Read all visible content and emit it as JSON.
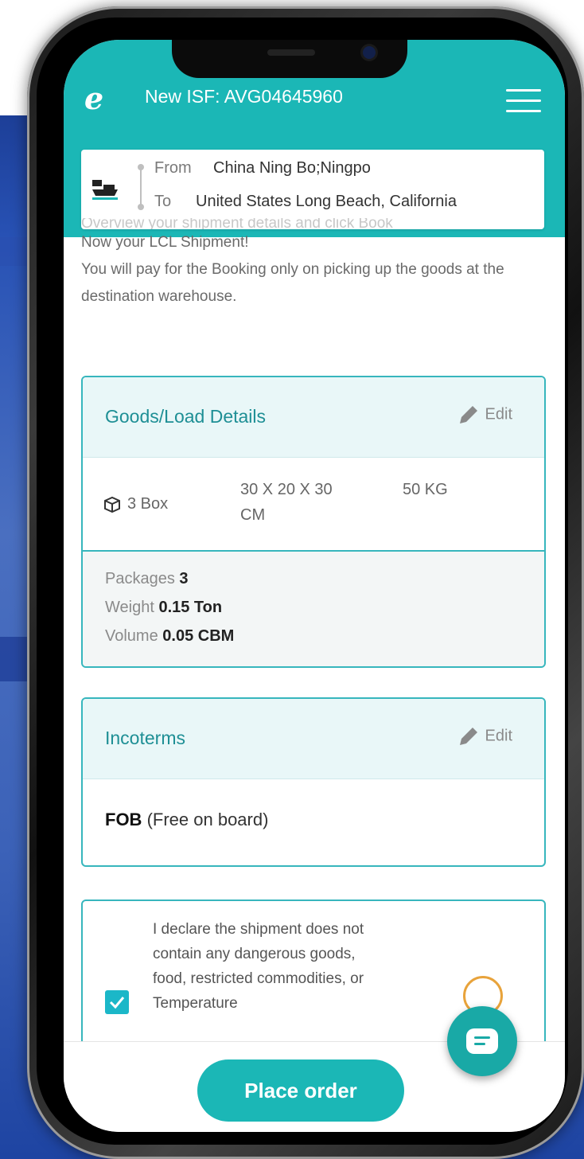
{
  "header": {
    "logo_text": "e",
    "title": "New ISF: AVG04645960",
    "menu_icon": "hamburger-icon"
  },
  "route": {
    "from_label": "From",
    "from_value": "China Ning Bo;Ningpo",
    "to_label": "To",
    "to_value": "United States Long Beach, California",
    "icon": "ship-icon"
  },
  "intro": {
    "line_faded": "Overview your shipment details and click Book",
    "line_1": "Now your LCL Shipment!",
    "line_2": "You will pay for the Booking only on picking up the goods at the destination warehouse."
  },
  "goods": {
    "title": "Goods/Load Details",
    "edit_label": "Edit",
    "quantity": "3 Box",
    "dimensions": "30 X 20 X 30 CM",
    "weight": "50 KG",
    "packages_label": "Packages",
    "packages_value": "3",
    "weight_label": "Weight",
    "weight_value": "0.15 Ton",
    "volume_label": "Volume",
    "volume_value": "0.05 CBM"
  },
  "incoterms": {
    "title": "Incoterms",
    "edit_label": "Edit",
    "code": "FOB",
    "description": "(Free on board)"
  },
  "declaration": {
    "text": "I declare the shipment does not contain any dangerous goods, food, restricted commodities, or Temperature",
    "checked": true
  },
  "actions": {
    "place_order_label": "Place order"
  },
  "colors": {
    "brand": "#1bb7b6",
    "card_border": "#37b6bd",
    "background": "#2852b5"
  }
}
